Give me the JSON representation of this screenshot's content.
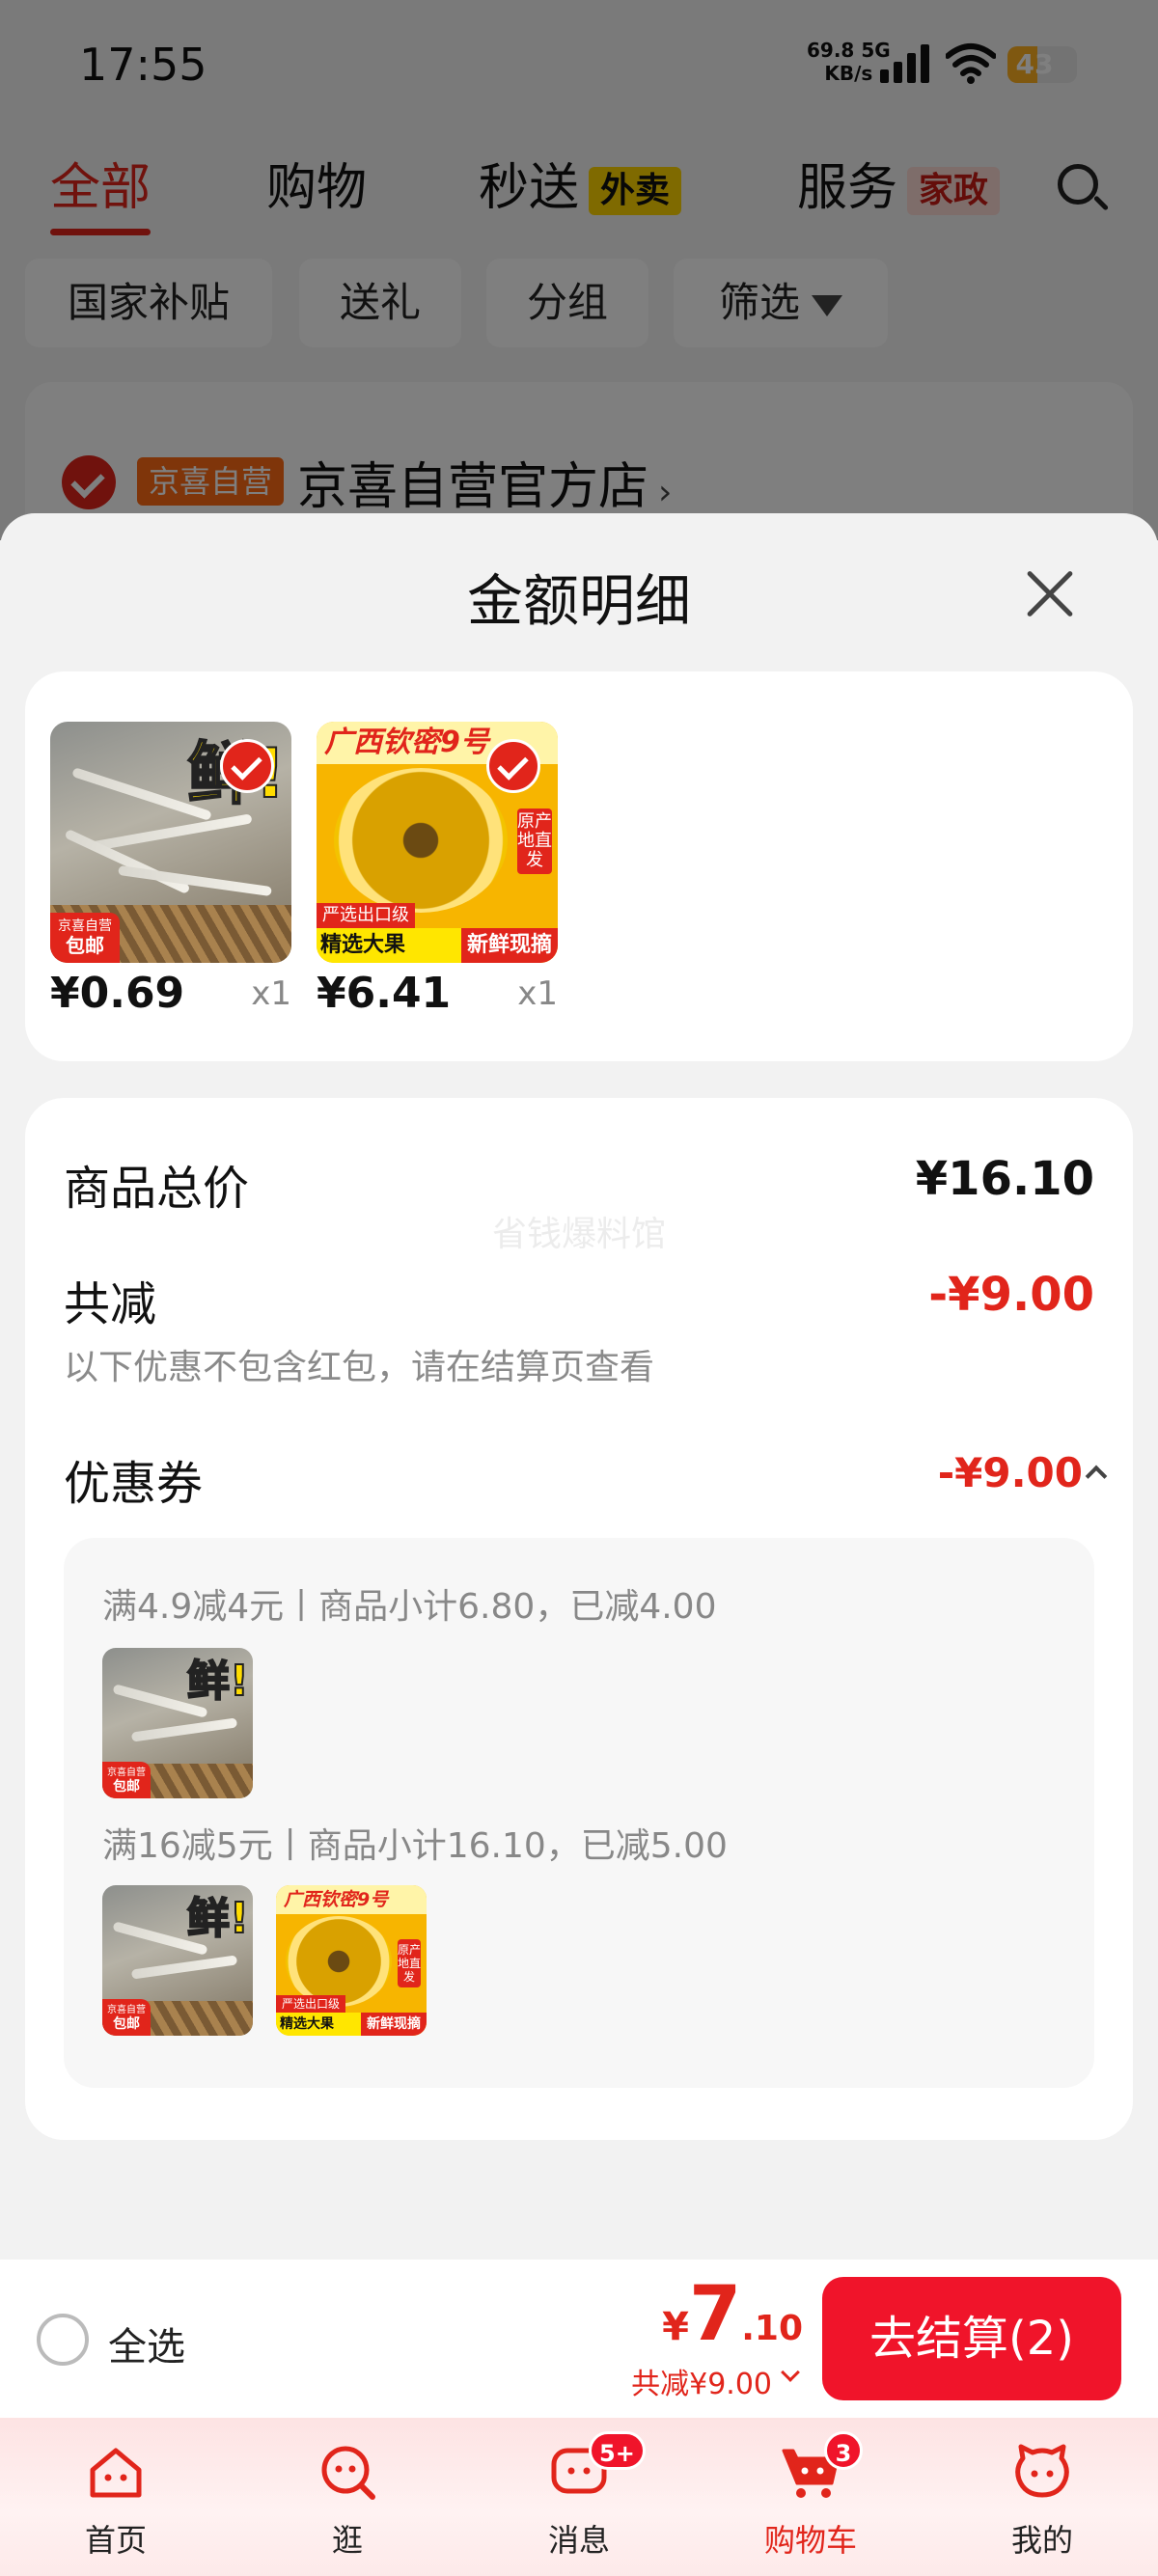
{
  "status_bar": {
    "time": "17:55",
    "net_speed": "69.8",
    "net_unit": "KB/s",
    "net_type": "5G",
    "battery": "43",
    "battery_level": 0.43
  },
  "top_tabs": [
    {
      "label": "全部",
      "active": true
    },
    {
      "label": "购物"
    },
    {
      "label": "秒送",
      "tag": "外卖"
    },
    {
      "label": "服务",
      "tag": "家政"
    }
  ],
  "filter_chips": [
    "国家补贴",
    "送礼",
    "分组",
    "筛选"
  ],
  "store": {
    "badge": "京喜自营",
    "name": "京喜自营官方店"
  },
  "sheet": {
    "title": "金额明细",
    "products": [
      {
        "price": "¥0.69",
        "qty": "x1",
        "image": {
          "big_char": "鲜!",
          "tag_top": "京喜自营",
          "tag_bottom": "包邮"
        }
      },
      {
        "price": "¥6.41",
        "qty": "x1",
        "image": {
          "head": "广西钦密9号",
          "side": "原产地直发",
          "bar1": "严选出口级",
          "bar2_left": "精选大果",
          "bar2_right": "新鲜现摘"
        }
      }
    ],
    "summary": {
      "total_label": "商品总价",
      "total_value": "¥16.10",
      "watermark": "省钱爆料馆",
      "discount_label": "共减",
      "discount_value": "-¥9.00",
      "discount_note": "以下优惠不包含红包，请在结算页查看",
      "coupon_label": "优惠券",
      "coupon_value": "-¥9.00",
      "coupon_rules": [
        {
          "text": "满4.9减4元丨商品小计6.80，已减4.00"
        },
        {
          "text": "满16减5元丨商品小计16.10，已减5.00"
        }
      ]
    }
  },
  "checkout": {
    "select_all": "全选",
    "price_currency": "¥",
    "price_int": "7",
    "price_dec": ".10",
    "discount": "共减¥9.00",
    "button": "去结算(2)"
  },
  "tab_bar": [
    {
      "label": "首页"
    },
    {
      "label": "逛"
    },
    {
      "label": "消息",
      "badge": "5+"
    },
    {
      "label": "购物车",
      "badge": "3",
      "active": true
    },
    {
      "label": "我的"
    }
  ],
  "colors": {
    "accent": "#e1251b",
    "checkout_button": "#f0142a",
    "coupon_box": "#f7f7f7"
  }
}
